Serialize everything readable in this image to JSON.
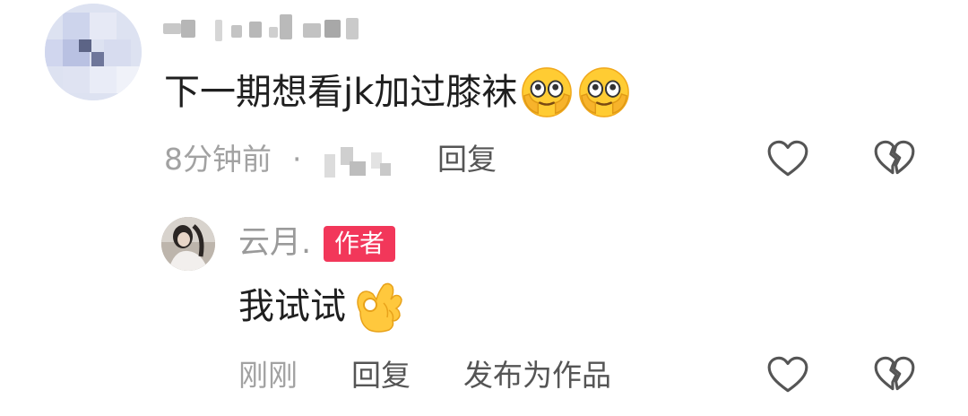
{
  "comment": {
    "text": "下一期想看jk加过膝袜",
    "emojis": [
      "peeking-face-emoji",
      "peeking-face-emoji"
    ],
    "time": "8分钟前",
    "separator": "·",
    "reply_label": "回复"
  },
  "reply": {
    "author": "云月.",
    "badge": "作者",
    "text": "我试试",
    "emoji": "ok-hand-emoji",
    "time": "刚刚",
    "reply_label": "回复",
    "publish_label": "发布为作品"
  },
  "colors": {
    "badge_bg": "#f2375a",
    "text_main": "#1f1f1f",
    "text_muted": "#a2a2a2",
    "icon_stroke": "#555555"
  }
}
